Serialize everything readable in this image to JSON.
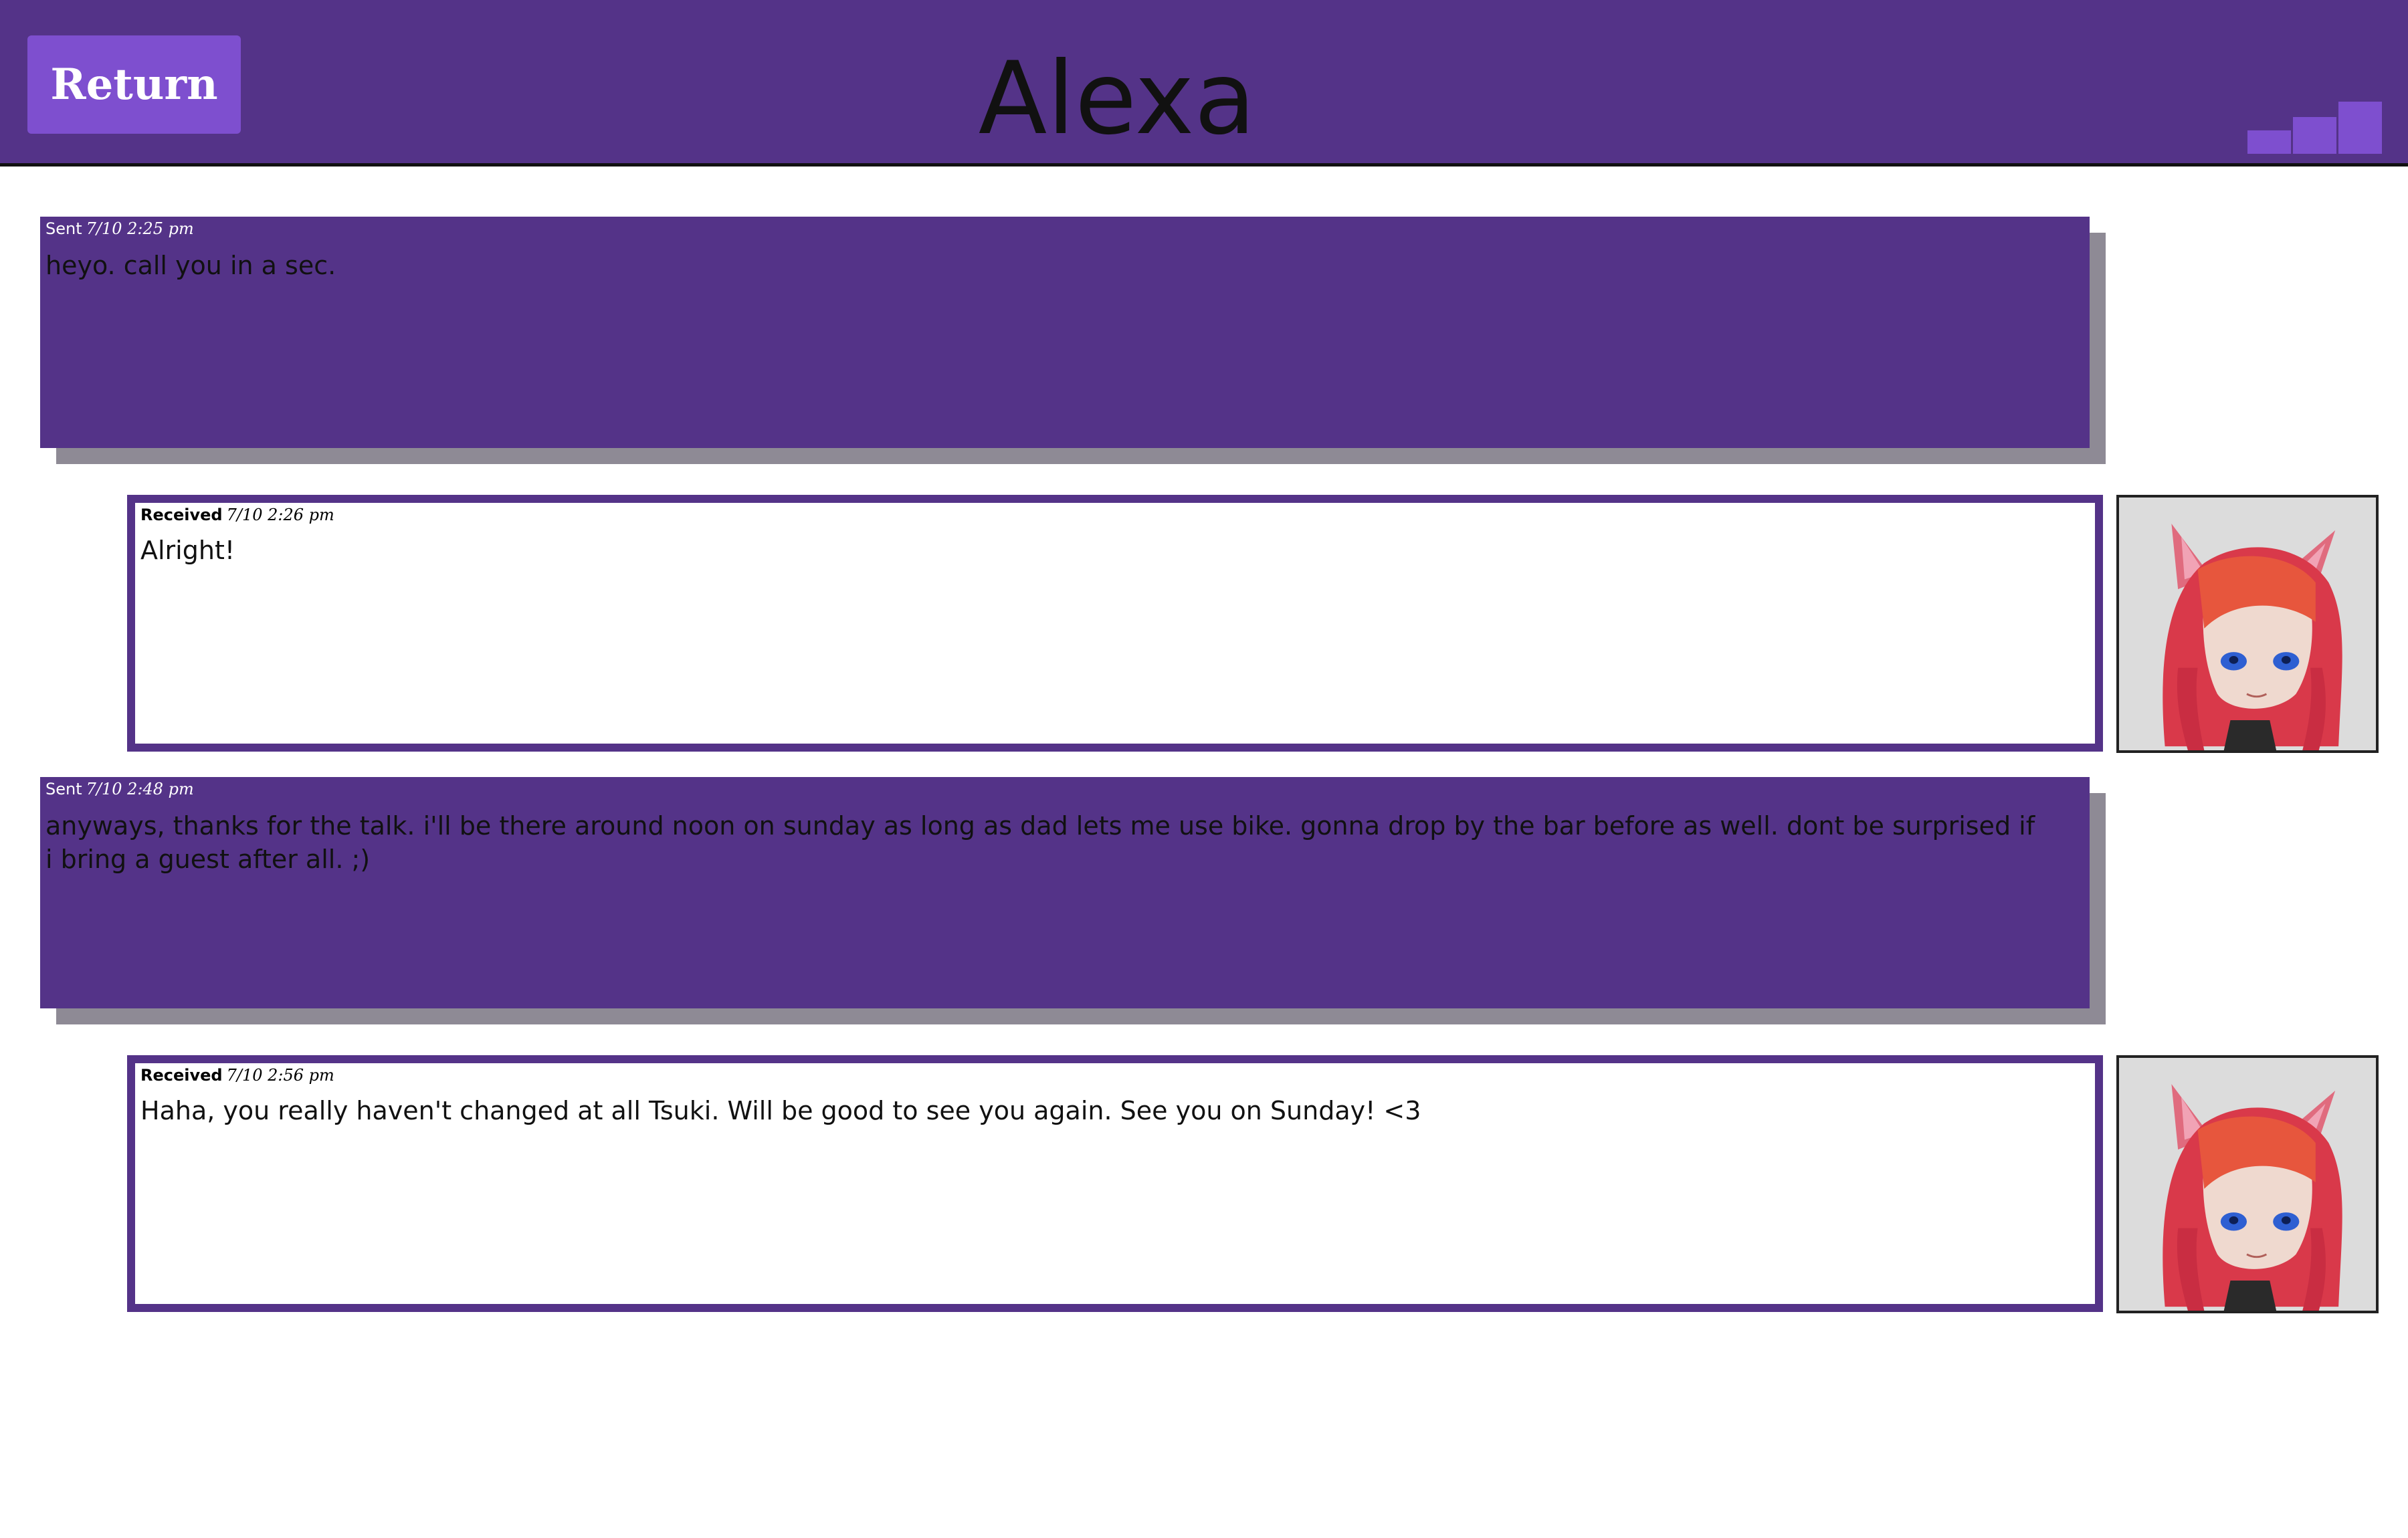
{
  "header": {
    "return_label": "Return",
    "contact_name": "Alexa",
    "signal_icon": "signal-bars-icon"
  },
  "colors": {
    "header_bg": "#543388",
    "accent": "#7e4fcf",
    "sent_bg": "#543388",
    "sent_shadow": "#8e8a95",
    "received_border": "#543388"
  },
  "messages": [
    {
      "direction": "sent",
      "label": "Sent",
      "time": "7/10 2:25 pm",
      "text": "heyo. call you in a sec."
    },
    {
      "direction": "received",
      "label": "Received",
      "time": "7/10 2:26 pm",
      "text": "Alright!",
      "avatar_icon": "contact-avatar-icon"
    },
    {
      "direction": "sent",
      "label": "Sent",
      "time": "7/10 2:48 pm",
      "text": "anyways, thanks for the talk. i'll be there around noon on sunday as long as dad lets me use bike. gonna drop by the bar before as well. dont be surprised if i bring a guest after all. ;)"
    },
    {
      "direction": "received",
      "label": "Received",
      "time": "7/10 2:56 pm",
      "text": "Haha, you really haven't changed at all Tsuki. Will be good to see you again. See you on Sunday! <3",
      "avatar_icon": "contact-avatar-icon"
    }
  ]
}
